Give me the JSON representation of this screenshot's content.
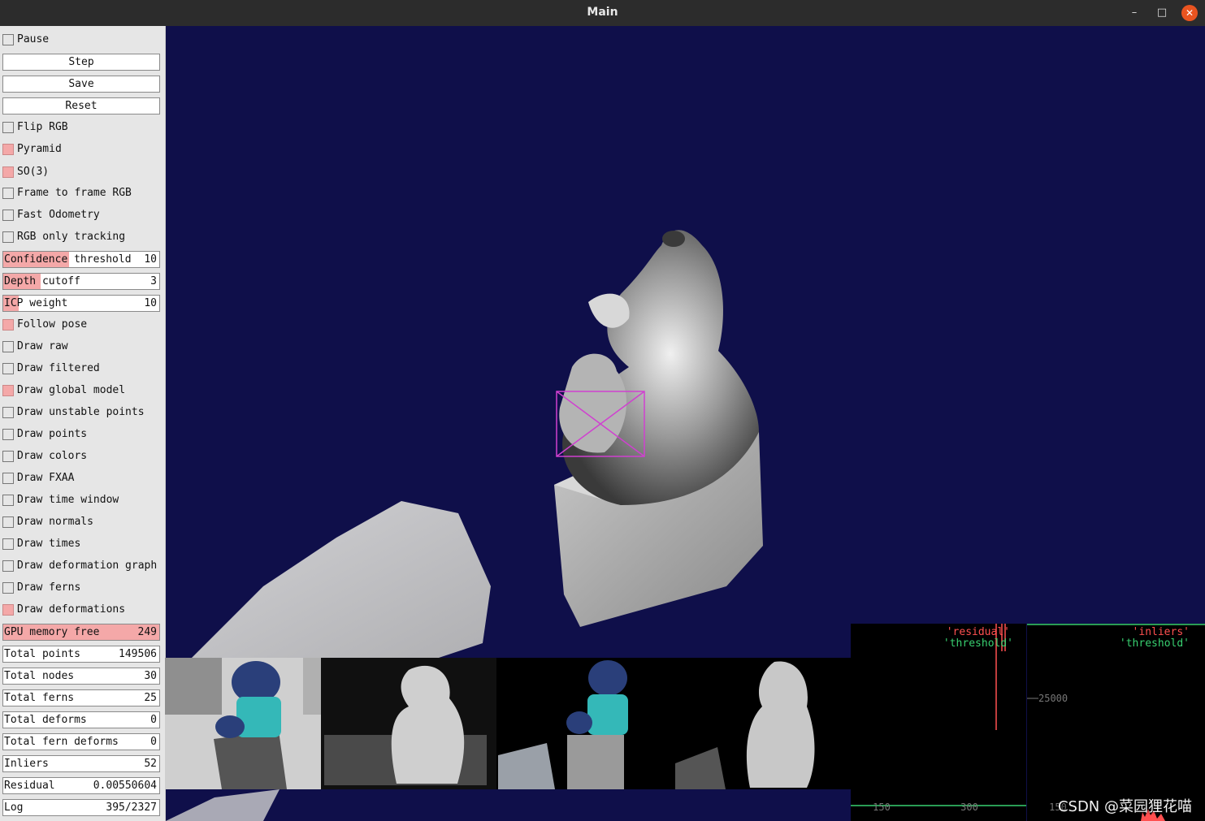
{
  "window": {
    "title": "Main",
    "controls": [
      "–",
      "□",
      "✕"
    ]
  },
  "controls": {
    "pause": {
      "label": "Pause",
      "checked": false
    },
    "step_label": "Step",
    "save_label": "Save",
    "reset_label": "Reset",
    "flip_rgb": {
      "label": "Flip RGB",
      "checked": false
    },
    "pyramid": {
      "label": "Pyramid",
      "checked": true
    },
    "so3": {
      "label": "SO(3)",
      "checked": true
    },
    "frame_to_frame_rgb": {
      "label": "Frame to frame RGB",
      "checked": false
    },
    "fast_odometry": {
      "label": "Fast Odometry",
      "checked": false
    },
    "rgb_only_tracking": {
      "label": "RGB only tracking",
      "checked": false
    },
    "confidence_threshold": {
      "label": "Confidence threshold",
      "value": "10",
      "fraction": 0.42
    },
    "depth_cutoff": {
      "label": "Depth cutoff",
      "value": "3",
      "fraction": 0.24
    },
    "icp_weight": {
      "label": "ICP weight",
      "value": "10",
      "fraction": 0.1
    },
    "follow_pose": {
      "label": "Follow pose",
      "checked": true
    },
    "draw_raw": {
      "label": "Draw raw",
      "checked": false
    },
    "draw_filtered": {
      "label": "Draw filtered",
      "checked": false
    },
    "draw_global_model": {
      "label": "Draw global model",
      "checked": true
    },
    "draw_unstable_points": {
      "label": "Draw unstable points",
      "checked": false
    },
    "draw_points": {
      "label": "Draw points",
      "checked": false
    },
    "draw_colors": {
      "label": "Draw colors",
      "checked": false
    },
    "draw_fxaa": {
      "label": "Draw FXAA",
      "checked": false
    },
    "draw_time_window": {
      "label": "Draw time window",
      "checked": false
    },
    "draw_normals": {
      "label": "Draw normals",
      "checked": false
    },
    "draw_times": {
      "label": "Draw times",
      "checked": false
    },
    "draw_deformation_graph": {
      "label": "Draw deformation graph",
      "checked": false
    },
    "draw_ferns": {
      "label": "Draw ferns",
      "checked": false
    },
    "draw_deformations": {
      "label": "Draw deformations",
      "checked": true
    }
  },
  "stats": {
    "gpu_memory_free": {
      "label": "GPU memory free",
      "value": "249",
      "fraction": 1.0
    },
    "total_points": {
      "label": "Total points",
      "value": "149506"
    },
    "total_nodes": {
      "label": "Total nodes",
      "value": "30"
    },
    "total_ferns": {
      "label": "Total ferns",
      "value": "25"
    },
    "total_deforms": {
      "label": "Total deforms",
      "value": "0"
    },
    "total_fern_deforms": {
      "label": "Total fern deforms",
      "value": "0"
    },
    "inliers": {
      "label": "Inliers",
      "value": "52"
    },
    "residual": {
      "label": "Residual",
      "value": "0.00550604"
    },
    "log": {
      "label": "Log",
      "value": "395/2327"
    }
  },
  "plots": {
    "residual_plot": {
      "legend_series": "'residual'",
      "legend_threshold": "'threshold'",
      "tick_a": "150",
      "tick_b": "300"
    },
    "inliers_plot": {
      "legend_series": "'inliers'",
      "legend_threshold": "'threshold'",
      "tick_y": "25000",
      "tick_x": "150"
    }
  },
  "colors": {
    "viewport_bg": "#0f0f4a",
    "checked": "#f4a8a8",
    "residual": "#ff5050",
    "threshold": "#38d070"
  },
  "watermark": "CSDN @菜园狸花喵"
}
